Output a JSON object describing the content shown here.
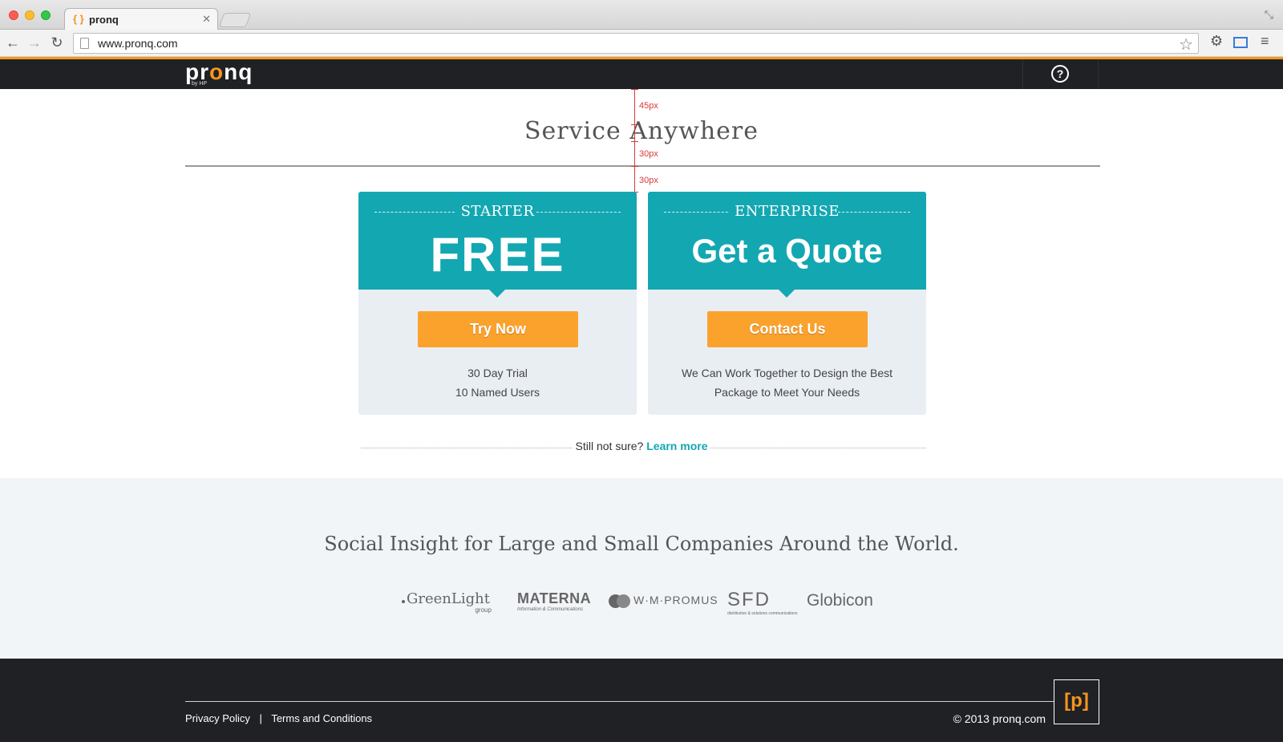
{
  "browser": {
    "tab_title": "pronq",
    "tab_favicon": "{ }",
    "url": "www.pronq.com"
  },
  "header": {
    "logo_text": "pronq",
    "logo_sub": "by HP",
    "help_icon": "?"
  },
  "hero": {
    "title": "Service Anywhere"
  },
  "annotations": {
    "measure_1": "45px",
    "measure_2": "30px",
    "measure_3": "30px"
  },
  "plans": [
    {
      "tier": "STARTER",
      "price": "FREE",
      "cta": "Try Now",
      "desc_line1": "30 Day Trial",
      "desc_line2": "10 Named Users"
    },
    {
      "tier": "ENTERPRISE",
      "price": "Get a Quote",
      "cta": "Contact Us",
      "desc_line1": "We Can Work Together to Design the Best",
      "desc_line2": "Package to Meet Your Needs"
    }
  ],
  "not_sure": {
    "text": "Still not sure?",
    "link": "Learn more"
  },
  "clients": {
    "title": "Social Insight for Large and Small Companies Around the World.",
    "logos": [
      {
        "name": "GreenLight",
        "sub": "group"
      },
      {
        "name": "MATERNA",
        "sub": "Information & Communications"
      },
      {
        "name": "W·M·PROMUS",
        "sub": ""
      },
      {
        "name": "SFD",
        "sub": "distribution & solutions communications"
      },
      {
        "name": "Globicon",
        "sub": ""
      }
    ]
  },
  "footer": {
    "privacy": "Privacy Policy",
    "separator": "|",
    "terms": "Terms and Conditions",
    "copyright": "© 2013 pronq.com",
    "badge": "[p]"
  },
  "colors": {
    "brand_orange": "#f7941d",
    "teal": "#13a7b2",
    "cta_orange": "#fba22d",
    "dark": "#1f2124"
  }
}
